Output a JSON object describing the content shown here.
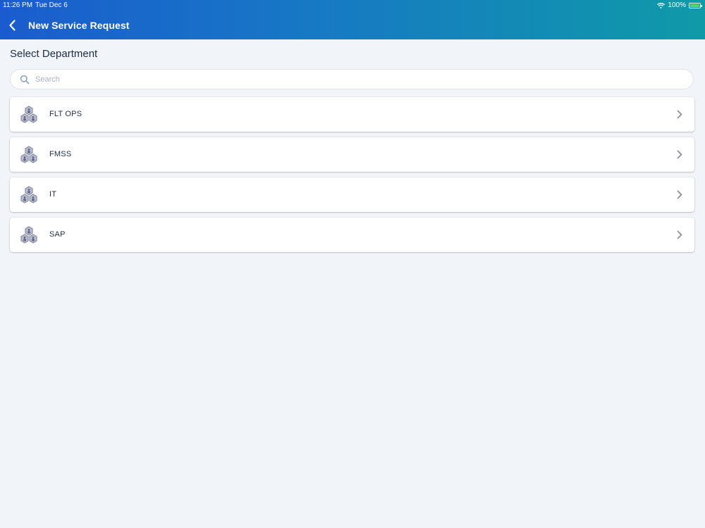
{
  "status_bar": {
    "time": "11:26 PM",
    "date": "Tue Dec 6",
    "battery": "100%",
    "icons": [
      "wifi-icon",
      "battery-icon"
    ]
  },
  "header": {
    "title": "New Service Request",
    "back_icon": "chevron-left-icon",
    "gradient": [
      "#1a5ccf",
      "#0f9aa8"
    ]
  },
  "section_title": "Select Department",
  "search": {
    "placeholder": "Search",
    "value": "",
    "icon": "search-icon"
  },
  "departments": [
    {
      "label": "FLT OPS",
      "icon": "department-icon",
      "chevron": "chevron-right-icon"
    },
    {
      "label": "FMSS",
      "icon": "department-icon",
      "chevron": "chevron-right-icon"
    },
    {
      "label": "IT",
      "icon": "department-icon",
      "chevron": "chevron-right-icon"
    },
    {
      "label": "SAP",
      "icon": "department-icon",
      "chevron": "chevron-right-icon"
    }
  ]
}
